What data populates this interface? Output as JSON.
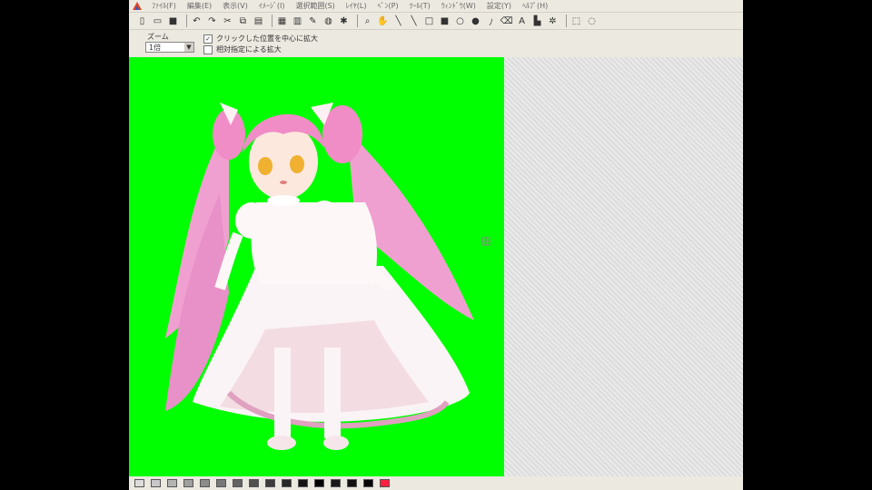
{
  "menu": {
    "items": [
      "ﾌｧｲﾙ(F)",
      "編集(E)",
      "表示(V)",
      "ｲﾒｰｼﾞ(I)",
      "選択範囲(S)",
      "ﾚｲﾔ(L)",
      "ﾍﾟﾝ(P)",
      "ﾂｰﾙ(T)",
      "ｳｨﾝﾄﾞｳ(W)",
      "設定(Y)",
      "ﾍﾙﾌﾟ(H)"
    ]
  },
  "toolbar": {
    "icons": [
      "new-icon",
      "open-icon",
      "save-icon",
      "sep",
      "undo-icon",
      "redo-icon",
      "cut-icon",
      "copy-icon",
      "paste-icon",
      "sep",
      "grid-icon",
      "layer-icon",
      "pen-icon",
      "bucket-icon",
      "effect-icon",
      "sep",
      "zoom-icon",
      "hand-icon",
      "line-icon",
      "pencil-icon",
      "rect-icon",
      "fill-rect-icon",
      "circle-icon",
      "fill-circle-icon",
      "dropper-icon",
      "eraser-icon",
      "text-icon",
      "stamp-icon",
      "brush-icon",
      "sep",
      "select-rect-icon",
      "select-lasso-icon"
    ]
  },
  "options": {
    "zoom_label": "ズーム",
    "zoom_value": "1倍",
    "option1_label": "クリックした位置を中心に拡大",
    "option1_checked": true,
    "option2_label": "相対指定による拡大",
    "option2_checked": false
  },
  "canvas": {
    "background": "#00ff00"
  },
  "palette": {
    "swatches": [
      "#dcdcdc",
      "#c8c8c8",
      "#b4b4b4",
      "#a0a0a0",
      "#8c8c8c",
      "#787878",
      "#646464",
      "#505050",
      "#3c3c3c",
      "#282828",
      "#141414",
      "#000000",
      "#1a1a1a",
      "#101010",
      "#080808",
      "#ff2040"
    ]
  }
}
